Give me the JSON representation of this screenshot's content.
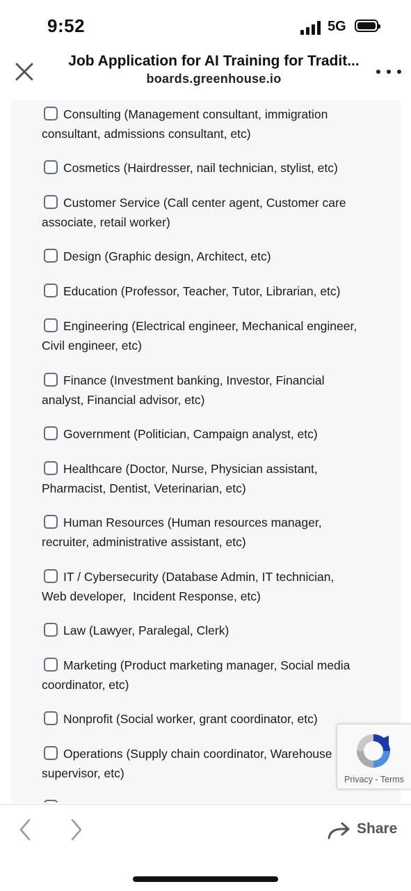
{
  "status_bar": {
    "time": "9:52",
    "network": "5G"
  },
  "header": {
    "title": "Job Application for AI Training for Tradit...",
    "url": "boards.greenhouse.io"
  },
  "options": [
    {
      "line1": "Consulting (Management consultant, immigration",
      "line2": "consultant, admissions consultant, etc)"
    },
    {
      "line1": "Cosmetics (Hairdresser, nail technician, stylist, etc)",
      "line2": ""
    },
    {
      "line1": "Customer Service (Call center agent, Customer care",
      "line2": "associate, retail worker)"
    },
    {
      "line1": "Design (Graphic design, Architect, etc)",
      "line2": ""
    },
    {
      "line1": "Education (Professor, Teacher, Tutor, Librarian, etc)",
      "line2": ""
    },
    {
      "line1": "Engineering (Electrical engineer, Mechanical engineer,",
      "line2": "Civil engineer, etc)"
    },
    {
      "line1": "Finance (Investment banking, Investor, Financial",
      "line2": "analyst, Financial advisor, etc)"
    },
    {
      "line1": "Government (Politician, Campaign analyst, etc)",
      "line2": ""
    },
    {
      "line1": "Healthcare (Doctor, Nurse, Physician assistant,",
      "line2": "Pharmacist, Dentist, Veterinarian, etc)"
    },
    {
      "line1": "Human Resources (Human resources manager,",
      "line2": "recruiter, administrative assistant, etc)"
    },
    {
      "line1": "IT / Cybersecurity (Database Admin, IT technician,",
      "line2": "Web developer,  Incident Response, etc)"
    },
    {
      "line1": "Law (Lawyer, Paralegal, Clerk)",
      "line2": ""
    },
    {
      "line1": "Marketing (Product marketing manager, Social media",
      "line2": "coordinator, etc)"
    },
    {
      "line1": "Nonprofit (Social worker, grant coordinator, etc)",
      "line2": ""
    },
    {
      "line1": "Operations (Supply chain coordinator, Warehouse",
      "line2": "supervisor, etc)"
    },
    {
      "line1": "",
      "line2": ""
    }
  ],
  "recaptcha": {
    "privacy": "Privacy",
    "separator": " - ",
    "terms": "Terms"
  },
  "toolbar": {
    "share_label": "Share"
  }
}
